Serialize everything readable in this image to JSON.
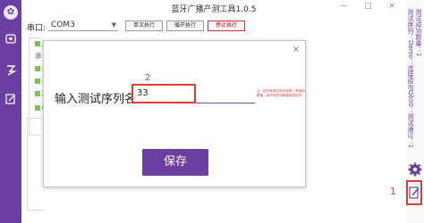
{
  "app": {
    "title": "蓝牙广播产测工具1.0.5",
    "window_controls": "— □ ×"
  },
  "toolbar": {
    "port_label": "串口:",
    "port_value": "COM3",
    "btn_once": "单次执行",
    "btn_loop": "循环执行",
    "btn_stop": "停止执行"
  },
  "background": {
    "rows": [
      "选",
      "添",
      "关",
      "开",
      "冷",
      "帧"
    ]
  },
  "right_strip": {
    "info_line1": "测试序列：Demo：连接成功Q600：测试通过：1",
    "info_line2": "测试成功数量：1"
  },
  "annotations": {
    "marker_1": "1",
    "marker_2": "2"
  },
  "modal": {
    "close": "×",
    "field_label": "输入测试序列名:",
    "input_value": "33",
    "hint": "注：如已有测试序列名称，再添加覆盖。如不存在则新建测试序列",
    "save_label": "保存"
  },
  "colors": {
    "brand_purple": "#6a3fa0",
    "annotation_red": "#e53935"
  }
}
